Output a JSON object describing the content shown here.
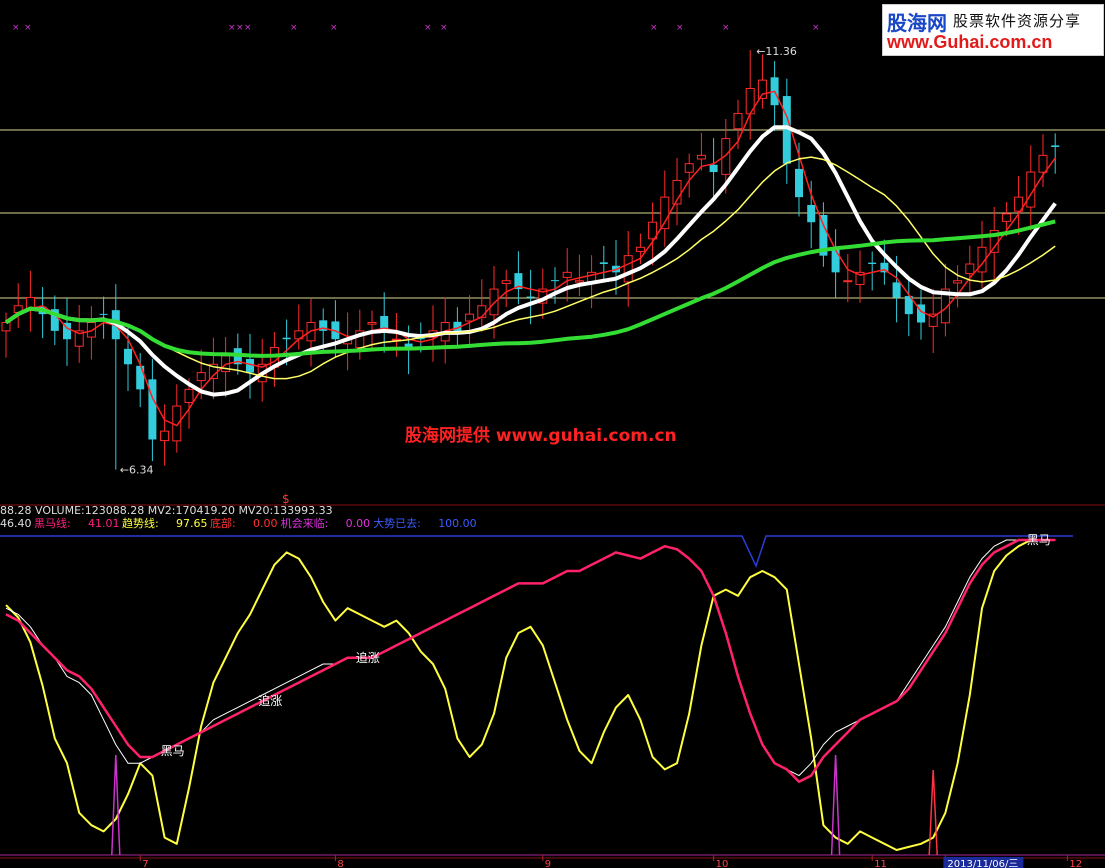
{
  "chart_data": [
    {
      "type": "candlestick",
      "panel": "price",
      "price_range": [
        6.0,
        11.6
      ],
      "labels": {
        "high": "11.36",
        "low": "6.34"
      },
      "signal_marker": "$",
      "overlay_lines": [
        {
          "name": "",
          "color": "#ffffff"
        },
        {
          "name": "",
          "color": "#ffff66"
        },
        {
          "name": "",
          "color": "#33dd33"
        },
        {
          "name": "",
          "color": "#ff2222"
        }
      ]
    },
    {
      "type": "line",
      "panel": "indicator",
      "y_range": [
        0,
        100
      ],
      "header": [
        {
          "text": "46.40",
          "color": "#dddddd"
        },
        {
          "text": "黑马线:",
          "color": "#ff2080"
        },
        {
          "text": "41.01",
          "color": "#ff2080"
        },
        {
          "text": "趋势线:",
          "color": "#ffff40"
        },
        {
          "text": "97.65",
          "color": "#ffff40"
        },
        {
          "text": "底部:",
          "color": "#ff3333"
        },
        {
          "text": "0.00",
          "color": "#ff3333"
        },
        {
          "text": "机会来临:",
          "color": "#dd33dd"
        },
        {
          "text": "0.00",
          "color": "#dd33dd"
        },
        {
          "text": "大势已去:",
          "color": "#3a5cff"
        },
        {
          "text": "100.00",
          "color": "#3a5cff"
        }
      ],
      "volume_header": "88.28   VOLUME:123088.28     MV2:170419.20  MV20:133993.33",
      "annotations": [
        {
          "text": "黑马",
          "index": 13
        },
        {
          "text": "追涨",
          "index": 21
        },
        {
          "text": "追涨",
          "index": 29
        },
        {
          "text": "黑马",
          "index": 84
        }
      ],
      "x_ticks": [
        {
          "text": "7",
          "index": 11
        },
        {
          "text": "8",
          "index": 27
        },
        {
          "text": "9",
          "index": 44
        },
        {
          "text": "10",
          "index": 58
        },
        {
          "text": "11",
          "index": 71
        },
        {
          "text": "2013/11/06/三",
          "index": 77,
          "highlight": true
        },
        {
          "text": "12",
          "index": 87
        }
      ],
      "series": [
        {
          "name": "",
          "color": "#ffff40",
          "values": [
            79,
            75,
            67,
            53,
            36,
            28,
            12,
            8,
            6,
            10,
            18,
            28,
            24,
            4,
            2,
            20,
            40,
            54,
            62,
            70,
            76,
            84,
            92,
            96,
            94,
            88,
            80,
            74,
            78,
            76,
            74,
            72,
            74,
            70,
            64,
            60,
            52,
            36,
            30,
            34,
            44,
            62,
            70,
            72,
            66,
            54,
            42,
            32,
            28,
            38,
            46,
            50,
            42,
            30,
            26,
            28,
            44,
            66,
            82,
            84,
            82,
            88,
            90,
            88,
            84,
            60,
            36,
            8,
            4,
            2,
            6,
            4,
            2,
            0,
            1,
            2,
            4,
            12,
            28,
            50,
            78,
            90,
            95,
            98,
            100,
            102,
            104
          ],
          "comment_y_note": ""
        },
        {
          "name": "",
          "color": "#ffffff",
          "values": [
            78,
            76,
            72,
            66,
            62,
            56,
            54,
            50,
            42,
            34,
            28,
            28,
            30,
            32,
            34,
            36,
            38,
            42,
            44,
            46,
            48,
            50,
            52,
            54,
            56,
            58,
            60,
            60,
            62,
            62,
            62,
            64,
            66,
            68,
            70,
            72,
            74,
            76,
            78,
            80,
            82,
            84,
            86,
            86,
            86,
            88,
            90,
            90,
            92,
            94,
            96,
            95,
            94,
            96,
            98,
            97,
            94,
            90,
            82,
            70,
            56,
            44,
            34,
            28,
            26,
            24,
            28,
            34,
            38,
            40,
            42,
            44,
            46,
            48,
            54,
            60,
            66,
            72,
            80,
            88,
            94,
            98,
            100,
            102,
            104,
            102,
            106
          ]
        },
        {
          "name": "",
          "color": "#ff2268",
          "values": [
            76,
            74,
            70,
            66,
            62,
            58,
            56,
            52,
            46,
            40,
            34,
            30,
            30,
            32,
            34,
            36,
            38,
            40,
            42,
            44,
            46,
            48,
            50,
            52,
            54,
            56,
            58,
            60,
            62,
            62,
            62,
            64,
            66,
            68,
            70,
            72,
            74,
            76,
            78,
            80,
            82,
            84,
            86,
            86,
            86,
            88,
            90,
            90,
            92,
            94,
            96,
            95,
            94,
            96,
            98,
            97,
            94,
            90,
            82,
            70,
            56,
            44,
            34,
            28,
            26,
            22,
            24,
            30,
            34,
            38,
            42,
            44,
            46,
            48,
            52,
            58,
            64,
            70,
            78,
            86,
            92,
            96,
            98,
            100,
            102,
            100,
            104
          ]
        }
      ]
    }
  ]
}
